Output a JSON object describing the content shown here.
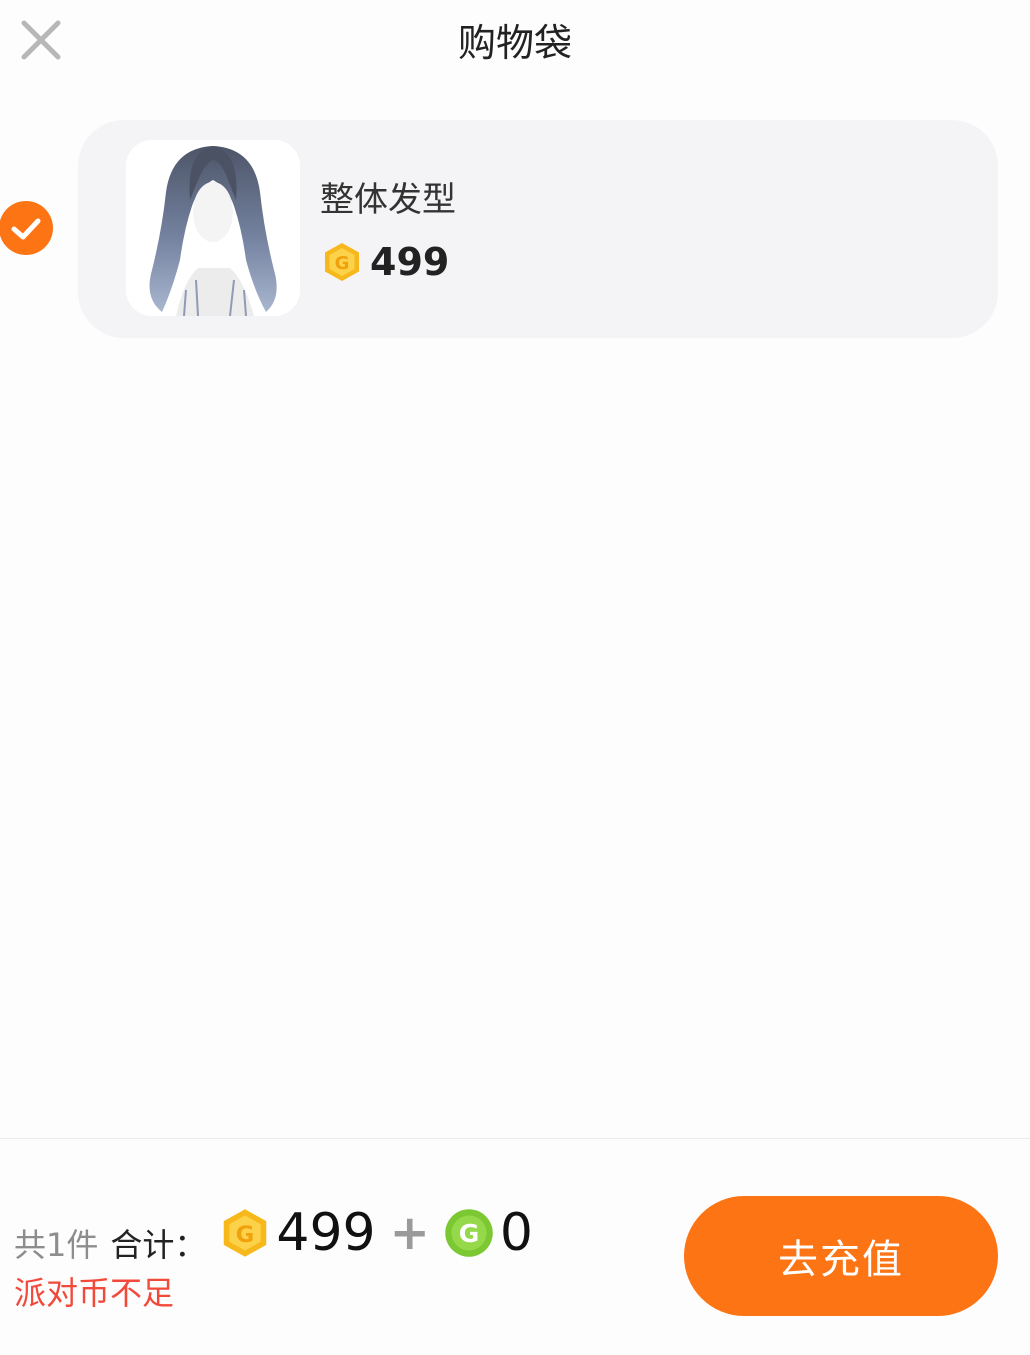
{
  "header": {
    "title": "购物袋"
  },
  "cart": {
    "items": [
      {
        "name": "整体发型",
        "price": "499",
        "selected": true
      }
    ]
  },
  "footer": {
    "count_text": "共1件",
    "total_label": "合计：",
    "gold_total": "499",
    "plus": "+",
    "green_total": "0",
    "warning": "派对币不足",
    "recharge_label": "去充值"
  },
  "colors": {
    "accent": "#fd7414",
    "warning": "#f24a3a",
    "gold_coin": "#f7b81c",
    "green_coin": "#7cc832"
  },
  "icons": {
    "close": "close-icon",
    "selected": "check-circle-icon",
    "gold_coin": "gold-coin-icon",
    "green_coin": "green-coin-icon"
  }
}
